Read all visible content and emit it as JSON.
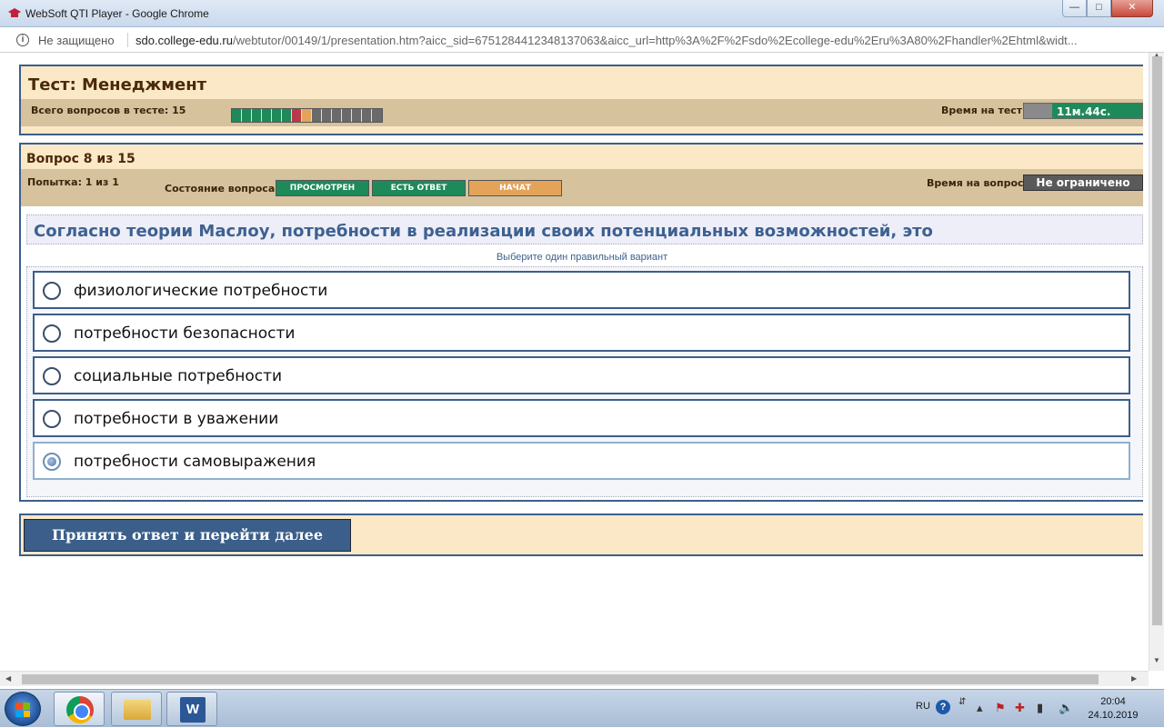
{
  "window": {
    "title": "WebSoft QTI Player - Google Chrome",
    "minimize": "—",
    "maximize": "□",
    "close": "✕"
  },
  "address": {
    "security": "Не защищено",
    "host": "sdo.college-edu.ru",
    "path": "/webtutor/00149/1/presentation.htm?aicc_sid=6751284412348137063&aicc_url=http%3A%2F%2Fsdo%2Ecollege-edu%2Eru%3A80%2Fhandler%2Ehtml&widt..."
  },
  "test": {
    "title": "Тест: Менеджмент",
    "total_label": "Всего вопросов в тесте: 15",
    "progress": [
      "answered",
      "answered",
      "answered",
      "answered",
      "answered",
      "answered",
      "error",
      "current",
      "none",
      "none",
      "none",
      "none",
      "none",
      "none",
      "none"
    ],
    "time_label": "Время на тест:",
    "time_value": "11м.44с.",
    "time_remaining_fraction": 0.76
  },
  "question": {
    "header": "Вопрос 8 из 15",
    "attempt": "Попытка: 1 из 1",
    "state_label": "Состояние вопроса:",
    "states": [
      "ПРОСМОТРЕН",
      "ЕСТЬ ОТВЕТ",
      "НАЧАТ"
    ],
    "time_label": "Время на вопрос:",
    "time_value": "Не ограничено",
    "text": "Согласно теории Маслоу, потребности в реализации своих потенциальных возможностей, это",
    "hint": "Выберите один правильный вариант",
    "options": [
      "физиологические потребности",
      "потребности безопасности",
      "социальные потребности",
      "потребности в уважении",
      "потребности самовыражения"
    ],
    "selected_index": 4
  },
  "submit_label": "Принять ответ и перейти далее",
  "taskbar": {
    "lang": "RU",
    "time": "20:04",
    "date": "24.10.2019",
    "word_letter": "W"
  },
  "colors": {
    "accent_blue": "#3b5f8a",
    "answered_green": "#1e8a5a",
    "current_orange": "#e3a45a",
    "panel_beige": "#fbe8c7"
  }
}
